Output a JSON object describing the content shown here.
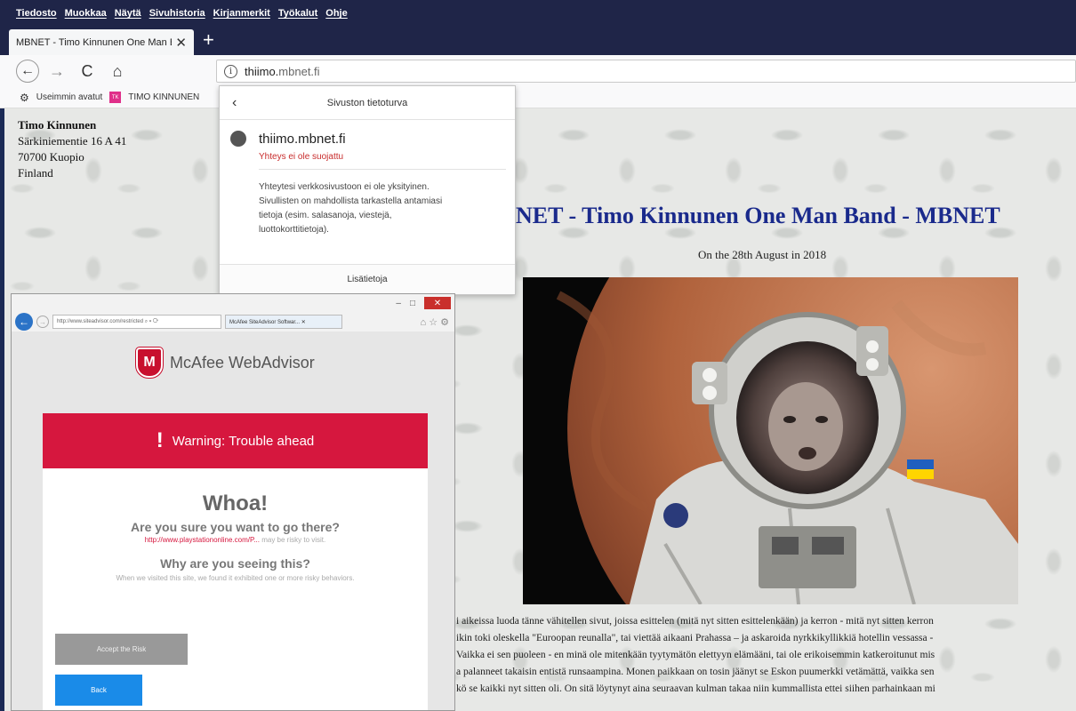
{
  "menu": [
    "Tiedosto",
    "Muokkaa",
    "Näytä",
    "Sivuhistoria",
    "Kirjanmerkit",
    "Työkalut",
    "Ohje"
  ],
  "tab": {
    "title": "MBNET - Timo Kinnunen One Man Band",
    "close": "✕",
    "new": "+"
  },
  "nav": {
    "back": "←",
    "forward": "→",
    "reload": "C",
    "home": "⌂"
  },
  "url": {
    "info": "i",
    "prefix": "thiimo.",
    "host": "mbnet.fi"
  },
  "bookmarks": {
    "frequent": "Useimmin avatut",
    "site": "TIMO KINNUNEN",
    "fav_text": "TK"
  },
  "address": {
    "name": "Timo Kinnunen",
    "street": "Särkiniementie 16 A 41",
    "city": "70700 Kuopio",
    "country": "Finland"
  },
  "site": {
    "title": "NET - Timo Kinnunen One Man Band - MBNET",
    "date": "On the 28th August in 2018",
    "paragraph": [
      "i aikeissa luoda tänne vähitellen sivut, joissa esittelen (mitä nyt sitten esittelenkään) ja kerron - mitä nyt sitten kerron",
      "ikin toki oleskella \"Euroopan reunalla\", tai viettää aikaani Prahassa – ja askaroida nyrkkikyllikkiä hotellin vessassa -",
      "Vaikka ei sen puoleen - en minä ole mitenkään tyytymätön elettyyn elämääni, tai ole erikoisemmin katkeroitunut mis",
      "a palanneet takaisin entistä runsaampina. Monen paikkaan on tosin jäänyt se Eskon puumerkki vetämättä, vaikka sen",
      "kö se kaikki nyt sitten oli. On sitä löytynyt aina seuraavan kulman takaa niin kummallista ettei siihen parhainkaan mi"
    ]
  },
  "popup": {
    "back": "‹",
    "title": "Sivuston tietoturva",
    "host": "thiimo.mbnet.fi",
    "insecure": "Yhteys ei ole suojattu",
    "desc": [
      "Yhteytesi verkkosivustoon ei ole yksityinen.",
      "Sivullisten on mahdollista tarkastella antamiasi",
      "tietoja (esim. salasanoja, viestejä,",
      "luottokorttitietoja)."
    ],
    "more": "Lisätietoja"
  },
  "ie": {
    "min": "–",
    "max": "□",
    "close": "✕",
    "address": "http://www.siteadvisor.com/restricted  ⌕ ▾ ⟳",
    "tab": "McAfee SiteAdvisor Softwar... ✕",
    "icons": "⌂ ☆ ⚙"
  },
  "mcafee": {
    "shield": "M",
    "brand": "McAfee WebAdvisor",
    "warning_mark": "!",
    "warning": "Warning: Trouble ahead",
    "whoa": "Whoa!",
    "question": "Are you sure you want to go there?",
    "url": "http://www.playstationonline.com/P...",
    "url_suffix": " may be risky to visit.",
    "why": "Why are you seeing this?",
    "why_desc": "When we visited this site, we found it exhibited one or more risky behaviors.",
    "accept": "Accept the Risk",
    "back": "Back"
  },
  "colors": {
    "menubar": "#1f2548",
    "site_title": "#1a2a8c",
    "mcafee_red": "#d6173e",
    "back_blue": "#1a8be8",
    "insecure_red": "#c82c2c"
  }
}
